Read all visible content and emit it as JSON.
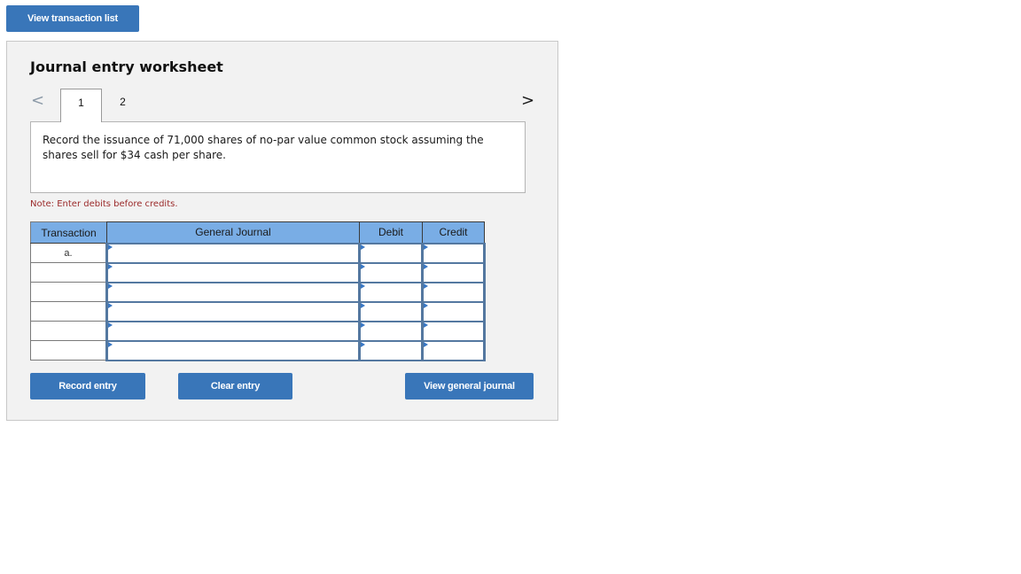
{
  "top_button": {
    "label": "View transaction list"
  },
  "worksheet": {
    "title": "Journal entry worksheet",
    "nav": {
      "prev_icon": "chevron-left-icon",
      "next_icon": "chevron-right-icon",
      "prev_glyph": "<",
      "next_glyph": ">"
    },
    "tabs": [
      {
        "label": "1",
        "active": true
      },
      {
        "label": "2",
        "active": false
      }
    ],
    "description": "Record the issuance of 71,000 shares of no-par value common stock assuming the shares sell for $34 cash per share.",
    "note": "Note: Enter debits before credits.",
    "table": {
      "headers": {
        "transaction": "Transaction",
        "general_journal": "General Journal",
        "debit": "Debit",
        "credit": "Credit"
      },
      "rows": [
        {
          "transaction": "a.",
          "account": "",
          "debit": "",
          "credit": ""
        },
        {
          "transaction": "",
          "account": "",
          "debit": "",
          "credit": ""
        },
        {
          "transaction": "",
          "account": "",
          "debit": "",
          "credit": ""
        },
        {
          "transaction": "",
          "account": "",
          "debit": "",
          "credit": ""
        },
        {
          "transaction": "",
          "account": "",
          "debit": "",
          "credit": ""
        },
        {
          "transaction": "",
          "account": "",
          "debit": "",
          "credit": ""
        }
      ]
    },
    "buttons": {
      "record": "Record entry",
      "clear": "Clear entry",
      "view_general_journal": "View general journal"
    }
  },
  "colors": {
    "button_blue": "#3976b9",
    "header_blue": "#79ade5",
    "cell_border": "#5478a0",
    "note_red": "#9b2a2a",
    "panel_bg": "#f2f2f2"
  }
}
